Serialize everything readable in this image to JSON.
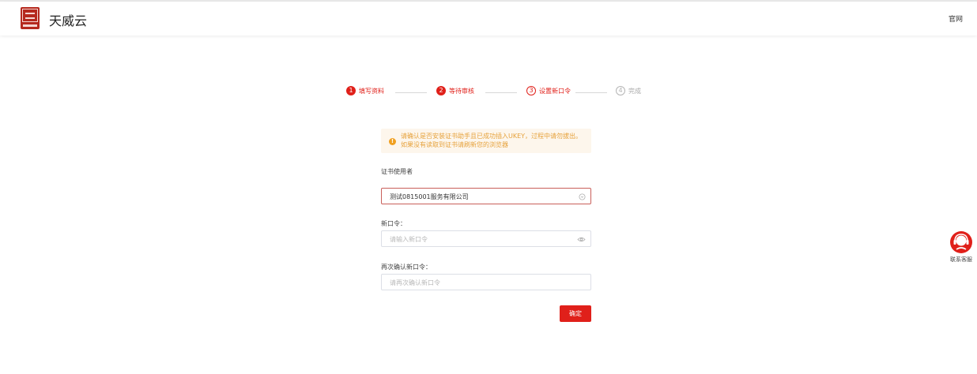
{
  "header": {
    "brand_name": "天威云",
    "official_site_label": "官网"
  },
  "steps": [
    {
      "number": "1",
      "label": "填写资料",
      "state": "done"
    },
    {
      "number": "2",
      "label": "等待审核",
      "state": "done"
    },
    {
      "number": "3",
      "label": "设置新口令",
      "state": "current"
    },
    {
      "number": "4",
      "label": "完成",
      "state": "pending"
    }
  ],
  "alert": {
    "icon": "warning-icon",
    "text": "请确认是否安装证书助手且已成功插入UKEY，过程中请勿拔出。如果没有读取到证书请刷新您的浏览器"
  },
  "form": {
    "cert_user_label": "证书使用者",
    "cert_user_value": "测试0815001服务有限公司",
    "new_password_label": "新口令：",
    "new_password_placeholder": "请输入新口令",
    "confirm_password_label": "再次确认新口令：",
    "confirm_password_placeholder": "请再次确认新口令",
    "submit_label": "确定"
  },
  "service": {
    "label": "联系客服",
    "icon": "headset-icon"
  },
  "colors": {
    "primary": "#e0201a",
    "warning_text": "#e6a23c",
    "warning_bg": "#fdf6ec"
  }
}
